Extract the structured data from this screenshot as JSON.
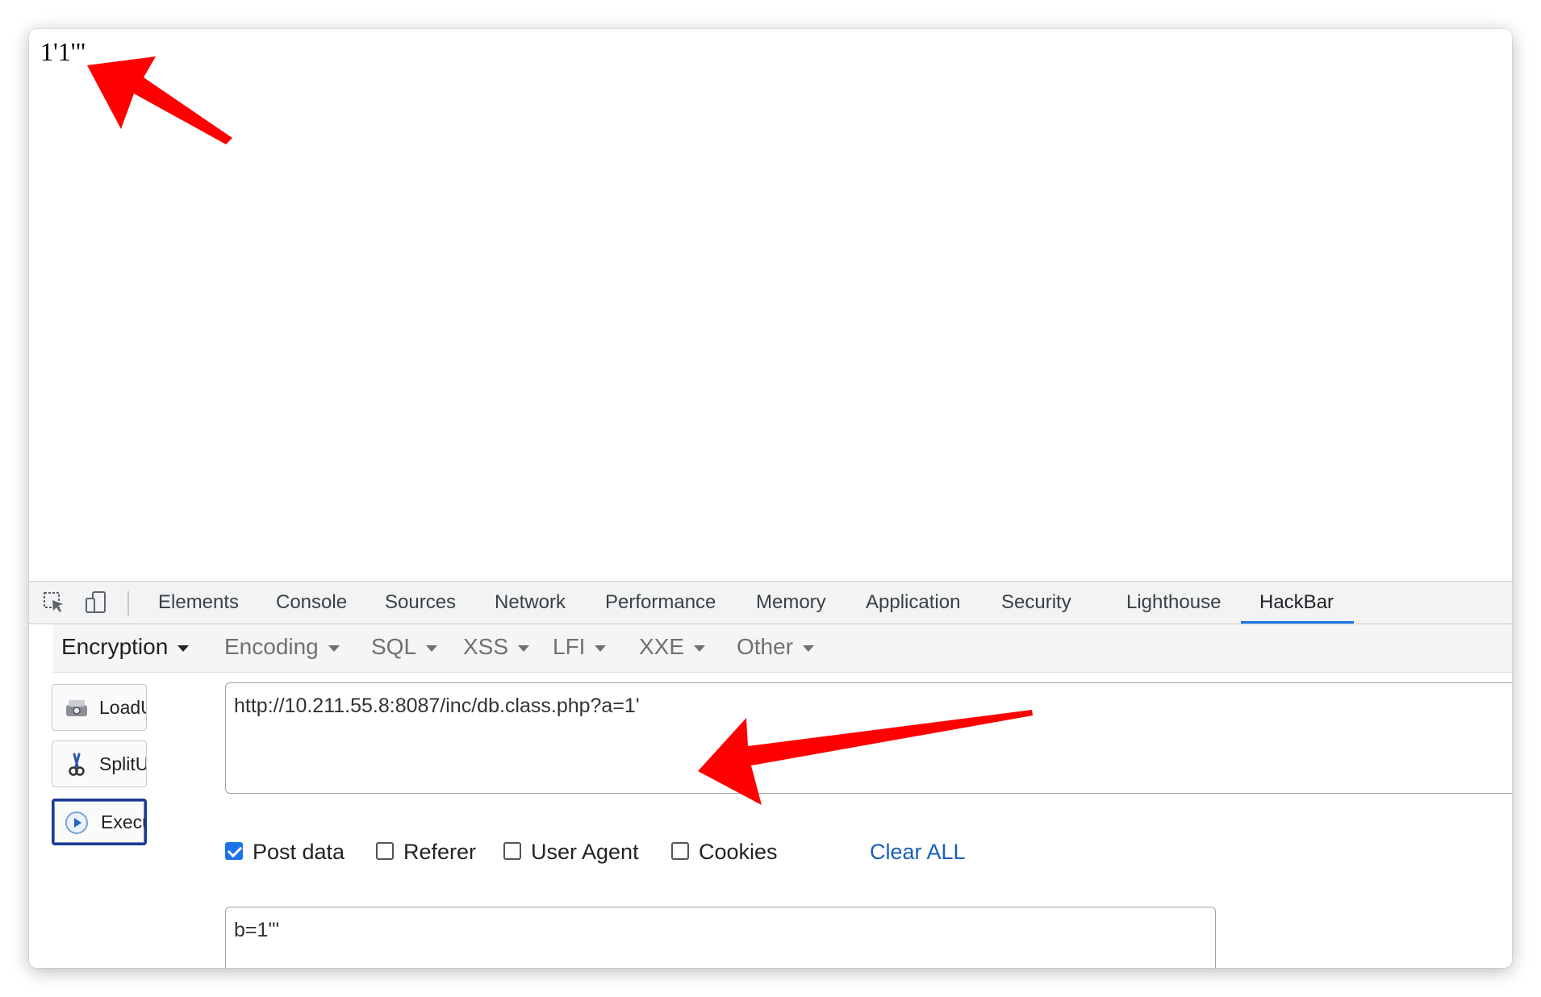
{
  "page": {
    "output_text": "1'1'\""
  },
  "devtools": {
    "tabs": [
      {
        "label": "Elements"
      },
      {
        "label": "Console"
      },
      {
        "label": "Sources"
      },
      {
        "label": "Network"
      },
      {
        "label": "Performance"
      },
      {
        "label": "Memory"
      },
      {
        "label": "Application"
      },
      {
        "label": "Security"
      },
      {
        "label": "Lighthouse"
      },
      {
        "label": "HackBar"
      }
    ],
    "active_tab": "HackBar",
    "accent_color": "#1a73e8"
  },
  "hackbar": {
    "menu": [
      {
        "label": "Encryption"
      },
      {
        "label": "Encoding"
      },
      {
        "label": "SQL"
      },
      {
        "label": "XSS"
      },
      {
        "label": "LFI"
      },
      {
        "label": "XXE"
      },
      {
        "label": "Other"
      }
    ],
    "buttons": {
      "load_url": "LoadUrl",
      "split_url": "SplitUrl",
      "execute": "Execute"
    },
    "url_value": "http://10.211.55.8:8087/inc/db.class.php?a=1'",
    "options": {
      "post_data": {
        "label": "Post data",
        "checked": true
      },
      "referer": {
        "label": "Referer",
        "checked": false
      },
      "user_agent": {
        "label": "User Agent",
        "checked": false
      },
      "cookies": {
        "label": "Cookies",
        "checked": false
      },
      "clear_all": "Clear ALL"
    },
    "post_value": "b=1'\""
  },
  "annotations": {
    "arrow_color": "#ff0000"
  }
}
